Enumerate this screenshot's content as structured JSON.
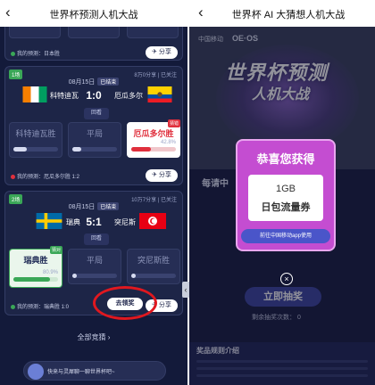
{
  "left": {
    "title": "世界杯预测人机大战",
    "back_icon": "‹",
    "card1": {
      "my_pick": "我的预测：日本胜",
      "share": "分享"
    },
    "card2": {
      "tag": "1场",
      "meta": "8万0分享 | 已关注",
      "date": "08月15日",
      "ended": "已结束",
      "home": "科特迪瓦",
      "away": "厄瓜多尔",
      "score": "1:0",
      "review": "回看",
      "options": [
        {
          "label": "科特迪瓦胜",
          "pct": "",
          "fill": 0
        },
        {
          "label": "平局",
          "pct": "",
          "fill": 0
        },
        {
          "label": "厄瓜多尔胜",
          "badge": "猜错",
          "pct": "42.8%",
          "fill": 0.43
        }
      ],
      "my_pick": "我的预测：厄瓜多尔胜 1:2",
      "share": "分享"
    },
    "card3": {
      "tag": "2场",
      "meta": "10万7分享 | 已关注",
      "date": "08月15日",
      "ended": "已结束",
      "home": "瑞典",
      "away": "突尼斯",
      "score": "5:1",
      "review": "回看",
      "options": [
        {
          "label": "瑞典胜",
          "badge": "猜对",
          "pct": "80.9%",
          "fill": 0.81
        },
        {
          "label": "平局",
          "pct": "",
          "fill": 0
        },
        {
          "label": "突尼斯胜",
          "pct": "",
          "fill": 0
        }
      ],
      "my_pick": "我的预测：瑞典胜 1:0",
      "claim": "去领奖",
      "share": "分享"
    },
    "all_matches": "全部竞猜",
    "bottom_text": "快来与灵犀聊一聊世界杯吧~",
    "side_toggle": "‹"
  },
  "right": {
    "title": "世界杯 AI 大猜想人机大战",
    "back_icon": "‹",
    "logo1": "中国移动",
    "logo2": "OE·OS",
    "hero_title": "世界杯预测",
    "hero_subtitle": "人机大战",
    "daily_label": "每请中",
    "modal": {
      "heading": "恭喜您获得",
      "line1": "1GB",
      "line2": "日包流量券",
      "go_button": "前往中国移动app使用"
    },
    "draw_button": "立即抽奖",
    "remaining": "剩余抽奖次数：  0",
    "rules_title": "奖品规则介绍",
    "close_icon": "×"
  },
  "colors": {
    "dark_bg": "#131a3a",
    "card_bg": "#1d2547",
    "accent_green": "#3aa757",
    "accent_red": "#e0303d",
    "modal_bg": "#c44dd1",
    "highlight_ring": "#e0181f"
  }
}
